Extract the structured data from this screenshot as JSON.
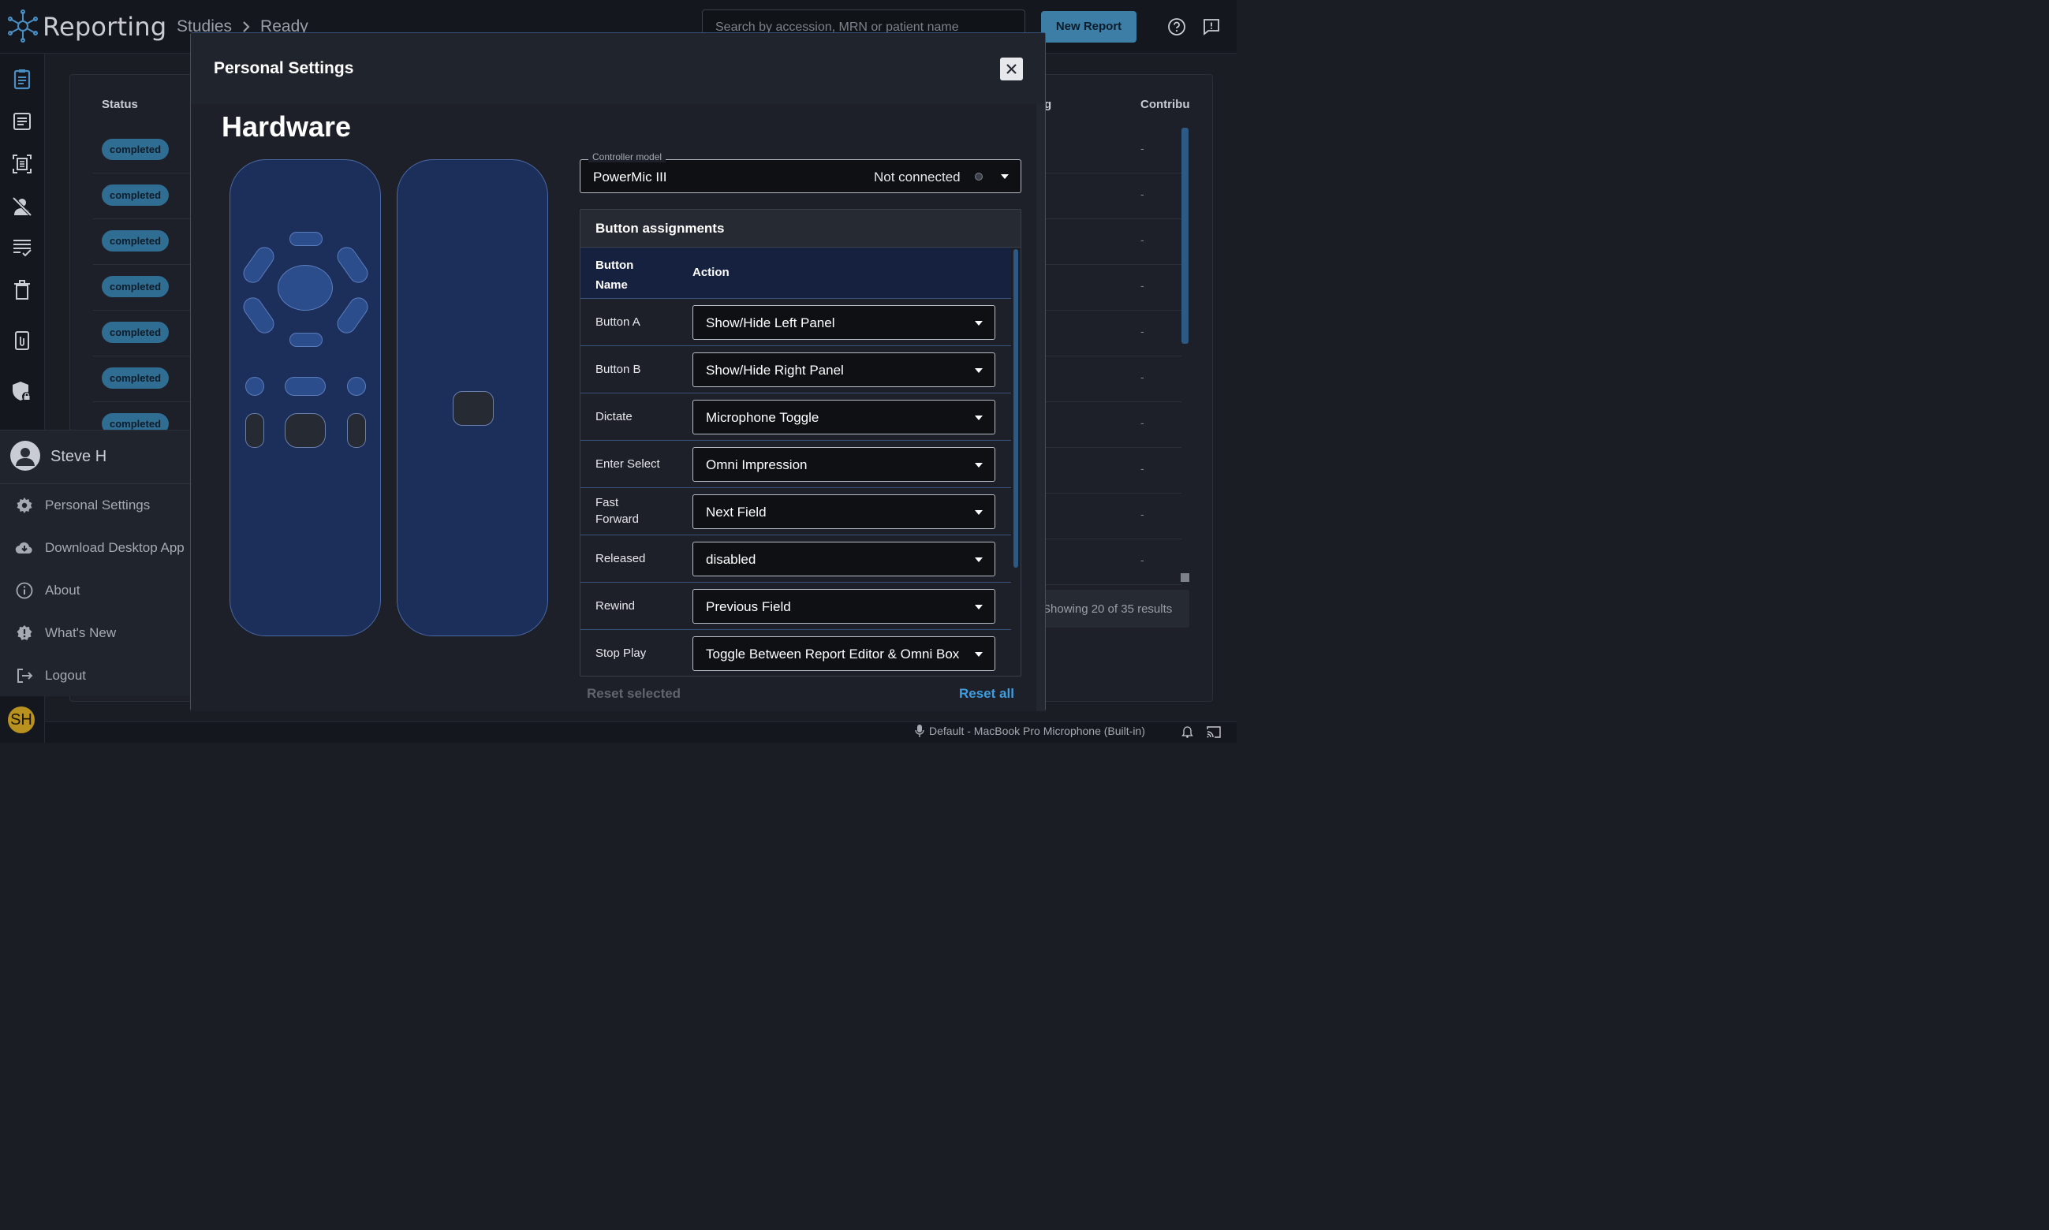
{
  "app": {
    "title": "Reporting",
    "breadcrumb": [
      "Studies",
      "Ready"
    ],
    "search_placeholder": "Search by accession, MRN or patient name",
    "new_report_label": "New Report"
  },
  "table": {
    "columns": {
      "status": "Status",
      "partial": "g",
      "contributors": "Contribu"
    },
    "rows": [
      {
        "status": "completed",
        "contrib": "-"
      },
      {
        "status": "completed",
        "contrib": "-"
      },
      {
        "status": "completed",
        "contrib": "-"
      },
      {
        "status": "completed",
        "contrib": "-"
      },
      {
        "status": "completed",
        "contrib": "-"
      },
      {
        "status": "completed",
        "contrib": "-"
      },
      {
        "status": "completed",
        "contrib": "-"
      },
      {
        "status": "",
        "contrib": "-"
      },
      {
        "status": "",
        "contrib": "-"
      },
      {
        "status": "",
        "contrib": "-"
      }
    ],
    "showing": "Showing 20 of 35 results"
  },
  "user_menu": {
    "name": "Steve H",
    "initials": "SH",
    "items": [
      {
        "label": "Personal Settings",
        "icon": "gear-icon"
      },
      {
        "label": "Download Desktop App",
        "icon": "cloud-download-icon"
      },
      {
        "label": "About",
        "icon": "info-icon"
      },
      {
        "label": "What's New",
        "icon": "badge-alert-icon"
      },
      {
        "label": "Logout",
        "icon": "logout-icon"
      }
    ]
  },
  "status_bar": {
    "microphone": "Default - MacBook Pro Microphone (Built-in)"
  },
  "modal": {
    "title": "Personal Settings",
    "section_title": "Hardware",
    "controller": {
      "legend": "Controller model",
      "value": "PowerMic III",
      "status": "Not connected"
    },
    "assignments": {
      "title": "Button assignments",
      "col_name": "Button Name",
      "col_action": "Action",
      "rows": [
        {
          "name": "Button A",
          "action": "Show/Hide Left Panel"
        },
        {
          "name": "Button B",
          "action": "Show/Hide Right Panel"
        },
        {
          "name": "Dictate",
          "action": "Microphone Toggle"
        },
        {
          "name": "Enter Select",
          "action": "Omni Impression"
        },
        {
          "name": "Fast Forward",
          "action": "Next Field"
        },
        {
          "name": "Released",
          "action": "disabled"
        },
        {
          "name": "Rewind",
          "action": "Previous Field"
        },
        {
          "name": "Stop Play",
          "action": "Toggle Between Report Editor & Omni Box"
        }
      ]
    },
    "reset_selected": "Reset selected",
    "reset_all": "Reset all"
  },
  "colors": {
    "accent": "#3d7ea6",
    "remote_body": "#1c2e5a",
    "remote_button": "#2b4d8c",
    "badge": "#2f6d92",
    "link": "#3d9de0"
  }
}
